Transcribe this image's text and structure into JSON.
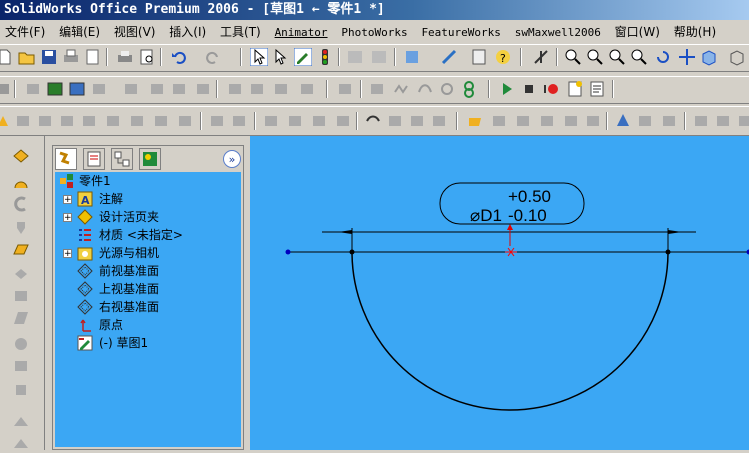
{
  "window": {
    "title": "SolidWorks Office Premium 2006 - [草图1 ← 零件1 *]"
  },
  "menu": [
    "文件(F)",
    "编辑(E)",
    "视图(V)",
    "插入(I)",
    "工具(T)",
    "Animator",
    "PhotoWorks",
    "FeatureWorks",
    "swMaxwell2006",
    "窗口(W)",
    "帮助(H)"
  ],
  "tree": {
    "root": "零件1",
    "items": [
      {
        "label": "注解",
        "icon": "annotation-icon",
        "expandable": true
      },
      {
        "label": "设计活页夹",
        "icon": "design-binder-icon",
        "expandable": true
      },
      {
        "label": "材质 <未指定>",
        "icon": "material-icon",
        "expandable": false
      },
      {
        "label": "光源与相机",
        "icon": "lights-cameras-icon",
        "expandable": true
      },
      {
        "label": "前视基准面",
        "icon": "plane-icon",
        "expandable": false
      },
      {
        "label": "上视基准面",
        "icon": "plane-icon",
        "expandable": false
      },
      {
        "label": "右视基准面",
        "icon": "plane-icon",
        "expandable": false
      },
      {
        "label": "原点",
        "icon": "origin-icon",
        "expandable": false
      },
      {
        "label": "(-) 草图1",
        "icon": "sketch-icon",
        "expandable": false
      }
    ]
  },
  "dimension": {
    "prefix": "⌀D1",
    "upper_tol": "+0.50",
    "lower_tol": "-0.10"
  },
  "colors": {
    "background": "#3ba7f4",
    "sketch_line": "#000000",
    "origin": "#ff0000",
    "title_bar": "#0a246a"
  }
}
